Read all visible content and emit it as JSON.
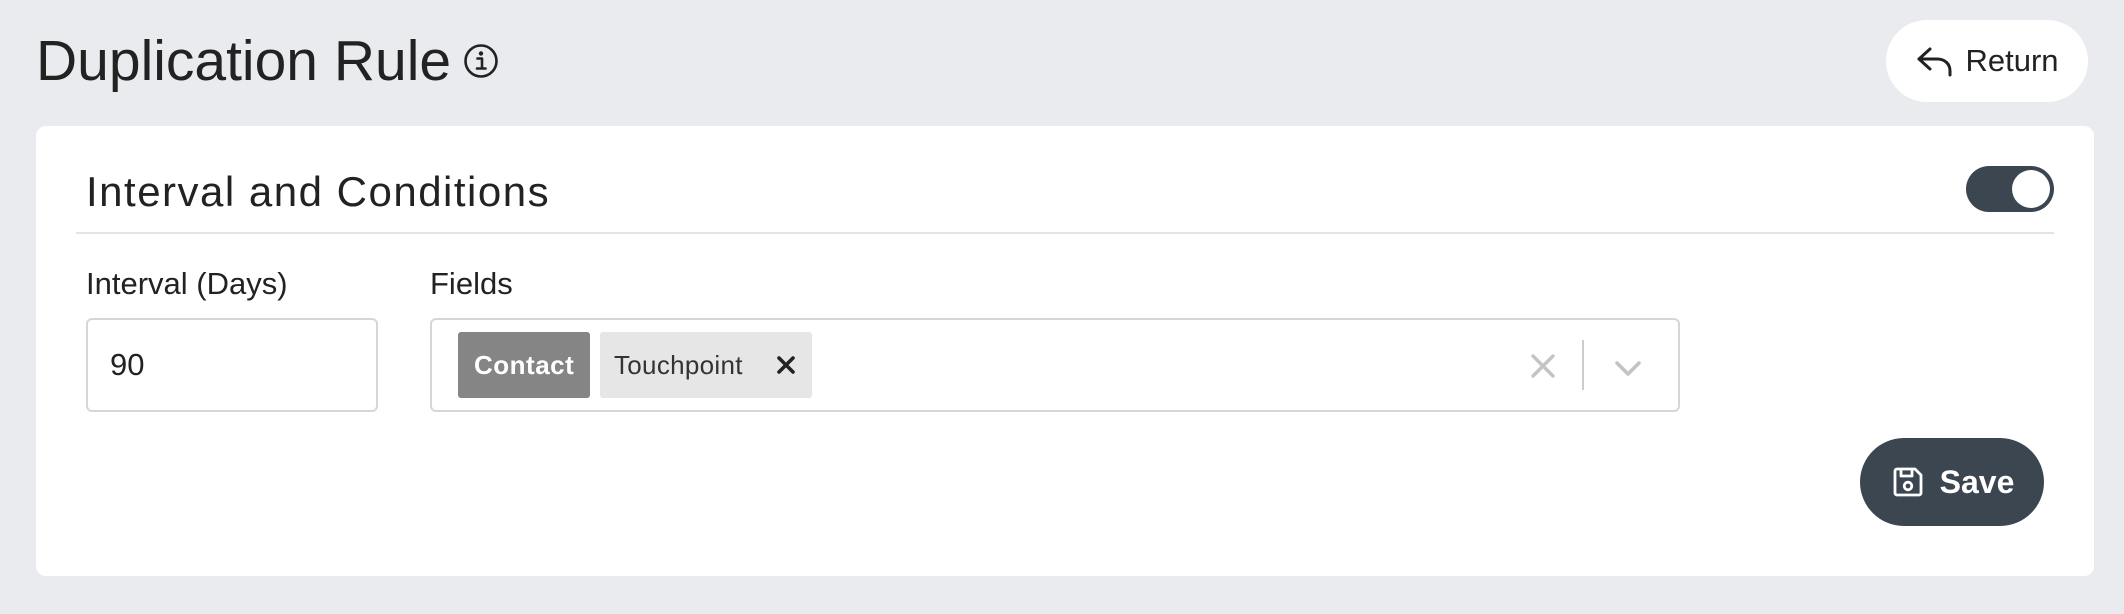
{
  "header": {
    "title": "Duplication Rule",
    "return_label": "Return"
  },
  "section": {
    "title": "Interval and Conditions",
    "enabled": true
  },
  "interval": {
    "label": "Interval (Days)",
    "value": "90"
  },
  "fields": {
    "label": "Fields",
    "tags": [
      {
        "label": "Contact",
        "removable": false
      },
      {
        "label": "Touchpoint",
        "removable": true
      }
    ]
  },
  "actions": {
    "save_label": "Save"
  },
  "icons": {
    "info": "info-icon",
    "return": "return-arrow-icon",
    "tag_remove": "close-icon",
    "clear": "clear-icon",
    "dropdown": "chevron-down-icon",
    "save": "floppy-disk-icon"
  },
  "colors": {
    "background": "#eaebee",
    "card": "#ffffff",
    "primary_dark": "#3b4651",
    "tag_locked": "#858585",
    "tag_default": "#e6e6e6"
  }
}
